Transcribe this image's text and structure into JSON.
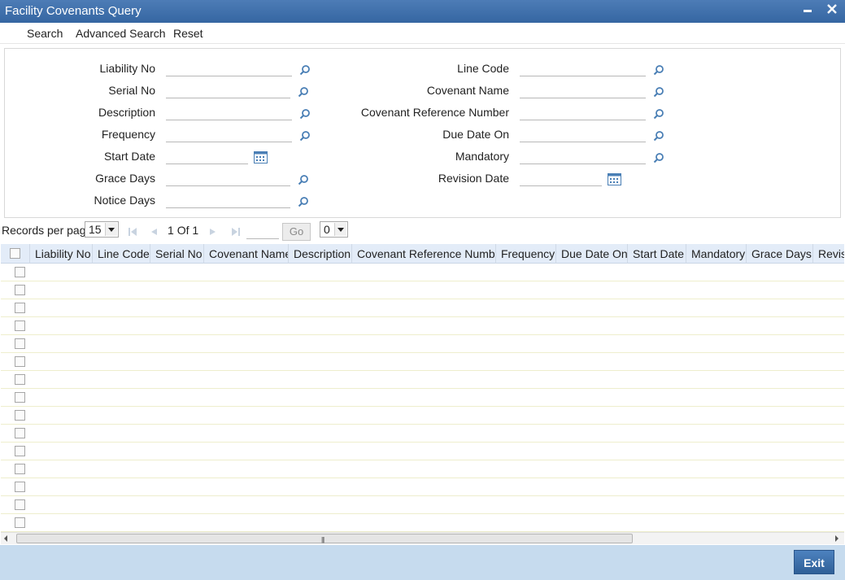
{
  "window": {
    "title": "Facility Covenants Query",
    "minimize_glyph": "–",
    "close_glyph": "✕"
  },
  "menu": {
    "items": [
      "Search",
      "Advanced Search",
      "Reset"
    ]
  },
  "search_form": {
    "left_fields": [
      {
        "label": "Liability No",
        "value": ""
      },
      {
        "label": "Serial No",
        "value": ""
      },
      {
        "label": "Description",
        "value": ""
      },
      {
        "label": "Frequency",
        "value": ""
      },
      {
        "label": "Start Date",
        "value": ""
      },
      {
        "label": "Grace Days",
        "value": ""
      },
      {
        "label": "Notice Days",
        "value": ""
      }
    ],
    "right_fields": [
      {
        "label": "Line Code",
        "value": ""
      },
      {
        "label": "Covenant Name",
        "value": ""
      },
      {
        "label": "Covenant Reference Number",
        "value": ""
      },
      {
        "label": "Due Date On",
        "value": ""
      },
      {
        "label": "Mandatory",
        "value": ""
      },
      {
        "label": "Revision Date",
        "value": ""
      }
    ]
  },
  "pager": {
    "records_per_page_label": "Records per page",
    "records_per_page_value": "15",
    "current_page": "1",
    "of_label": "Of",
    "total_pages": "1",
    "go_label": "Go",
    "extra_select_value": "0"
  },
  "grid": {
    "columns": [
      "Liability No",
      "Line Code",
      "Serial No",
      "Covenant Name",
      "Description",
      "Covenant Reference Number",
      "Frequency",
      "Due Date On",
      "Start Date",
      "Mandatory",
      "Grace Days",
      "Revisi"
    ],
    "row_count": 15
  },
  "footer": {
    "exit_label": "Exit"
  },
  "colors": {
    "titlebar": "#3f6ea8",
    "grid_header": "#e3ecf8",
    "footer": "#c6dbee",
    "icon_blue": "#4a7fb5"
  }
}
